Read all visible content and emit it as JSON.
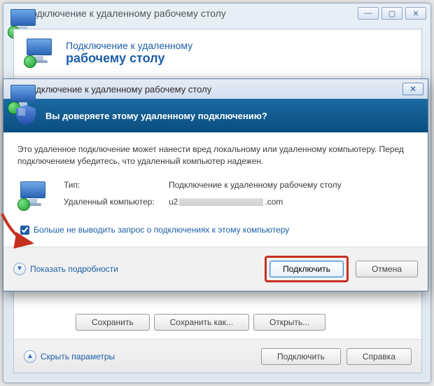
{
  "back": {
    "title": "Подключение к удаленному рабочему столу",
    "header_line1": "Подключение к удаленному",
    "header_line2": "рабочему столу",
    "buttons": {
      "save": "Сохранить",
      "save_as": "Сохранить как...",
      "open": "Открыть..."
    },
    "footer": {
      "hide_options": "Скрыть параметры",
      "connect": "Подключить",
      "help": "Справка"
    }
  },
  "dialog": {
    "title": "Подключение к удаленному рабочему столу",
    "band": "Вы доверяете этому удаленному подключению?",
    "desc": "Это удаленное подключение может нанести вред локальному или удаленному компьютеру. Перед подключением убедитесь, что удаленный компьютер надежен.",
    "rows": {
      "type_label": "Тип:",
      "type_value": "Подключение к удаленному рабочему столу",
      "host_label": "Удаленный компьютер:",
      "host_prefix": "u2",
      "host_suffix": ".com"
    },
    "checkbox_label": "Больше не выводить запрос о подключениях к этому компьютеру",
    "checkbox_checked": true,
    "details": "Показать подробности",
    "connect": "Подключить",
    "cancel": "Отмена"
  }
}
